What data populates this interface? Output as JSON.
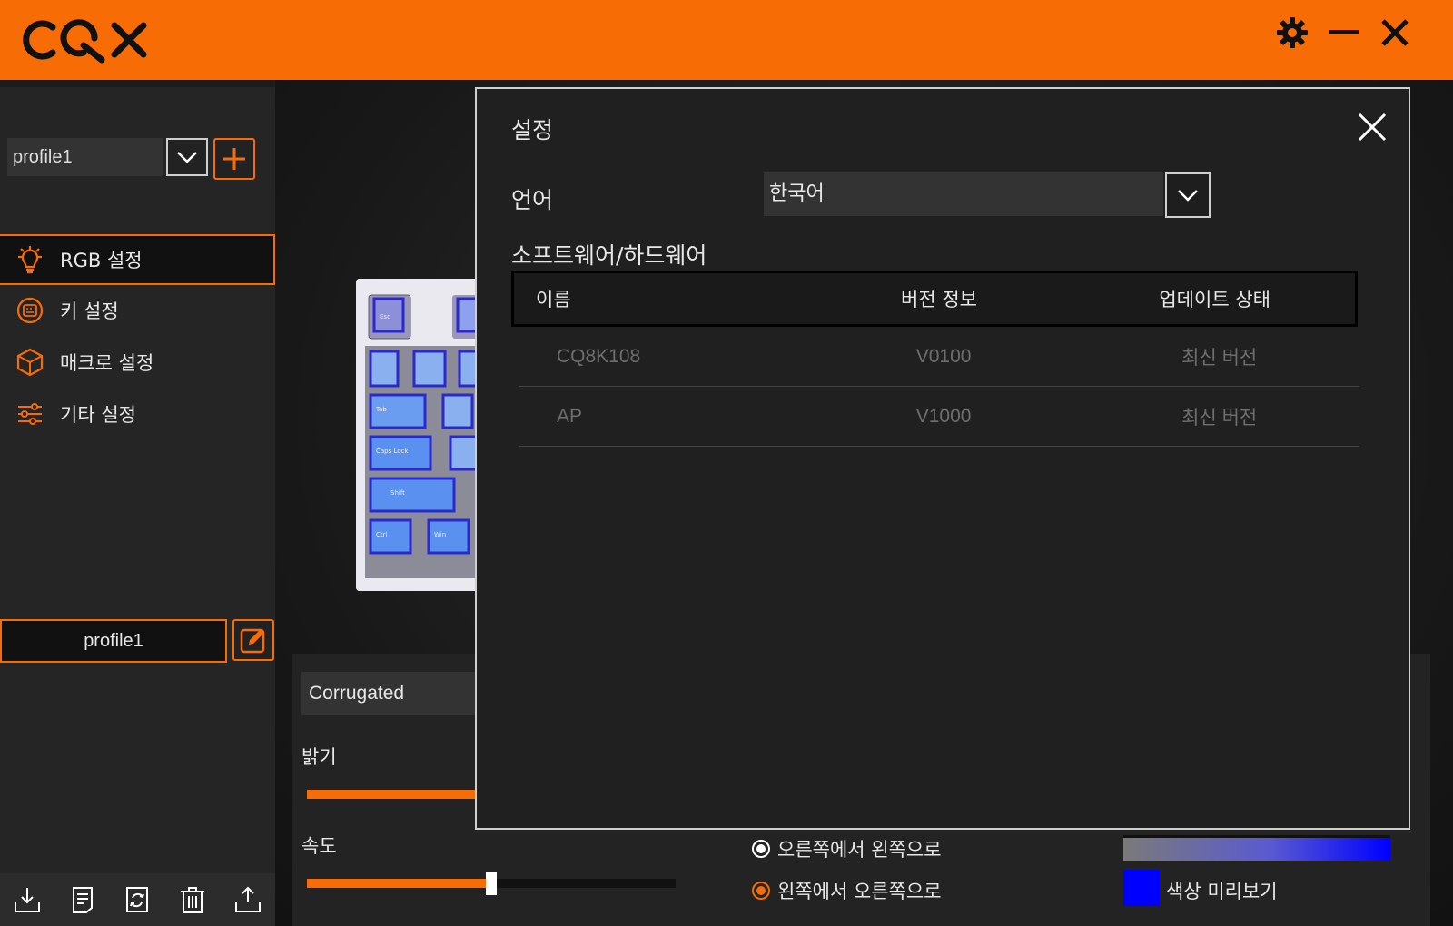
{
  "app": {
    "logo_text": "CQX"
  },
  "sidebar": {
    "profile_select": "profile1",
    "nav": [
      {
        "label": "RGB 설정",
        "icon": "lightbulb-icon",
        "active": true
      },
      {
        "label": "키 설정",
        "icon": "keyboard-circle-icon"
      },
      {
        "label": "매크로 설정",
        "icon": "cube-icon"
      },
      {
        "label": "기타 설정",
        "icon": "sliders-icon"
      }
    ],
    "profile_name": "profile1",
    "bottom_icons": [
      "import-icon",
      "document-icon",
      "refresh-icon",
      "trash-icon",
      "export-icon"
    ]
  },
  "keyboard_keys": [
    "Esc",
    "Tab",
    "Caps Lock",
    "Shift",
    "Ctrl",
    "Win"
  ],
  "rgb_panel": {
    "effect": "Corrugated",
    "brightness_label": "밝기",
    "speed_label": "속도",
    "speed_value": 0.5,
    "direction_options": [
      "오른쪽에서 왼쪽으로",
      "왼쪽에서 오른쪽으로"
    ],
    "color_preview_label": "색상 미리보기",
    "preview_color": "#0000ff"
  },
  "dialog": {
    "title": "설정",
    "language_label": "언어",
    "language_value": "한국어",
    "section_label": "소프트웨어/하드웨어",
    "columns": [
      "이름",
      "버전 정보",
      "업데이트 상태"
    ],
    "rows": [
      {
        "name": "CQ8K108",
        "version": "V0100",
        "status": "최신 버전"
      },
      {
        "name": "AP",
        "version": "V1000",
        "status": "최신 버전"
      }
    ]
  },
  "colors": {
    "accent": "#f86c05"
  }
}
